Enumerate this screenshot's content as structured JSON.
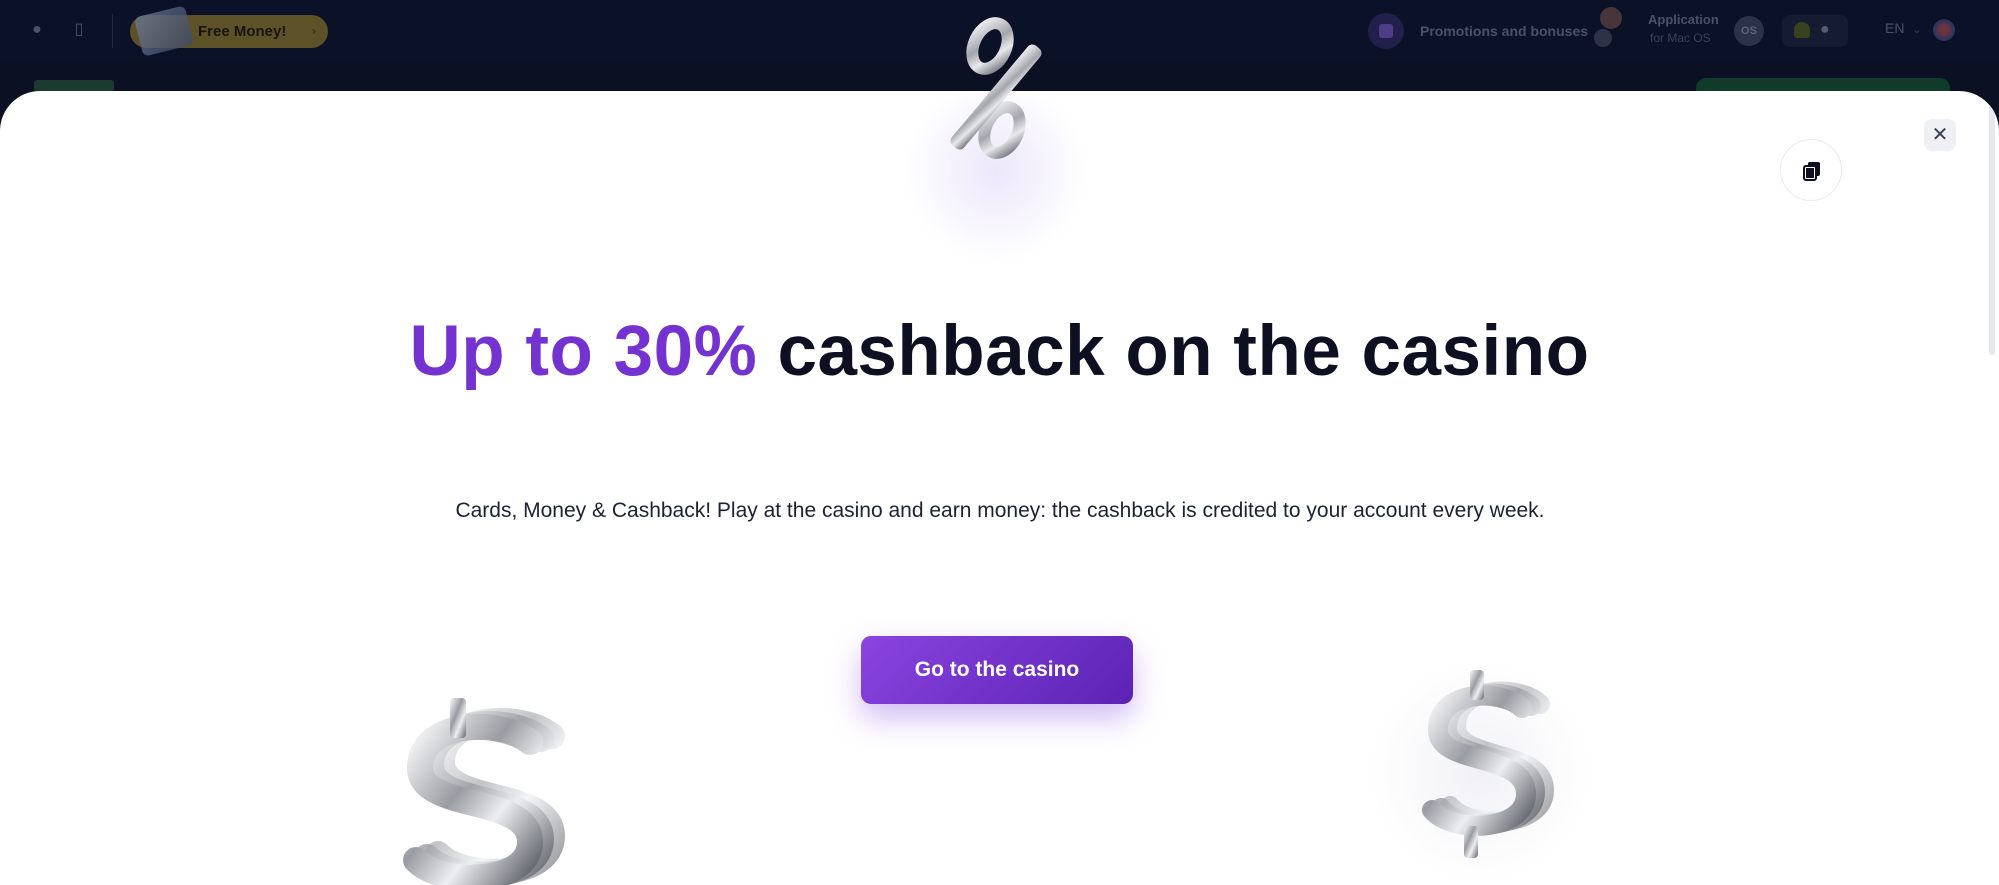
{
  "header": {
    "free_money_label": "Free Money!",
    "free_money_arrow": "›",
    "promotions_label": "Promotions and bonuses",
    "app_title": "Application",
    "app_subtitle": "for Mac OS",
    "app_badge": "OS",
    "language": "EN",
    "lang_chevron": "⌄"
  },
  "modal": {
    "close_symbol": "✕",
    "headline_accent": "Up to 30%",
    "headline_rest": " cashback on the casino",
    "subtitle": "Cards, Money & Cashback! Play at the casino and earn money: the cashback is credited to your account every week.",
    "cta_label": "Go to the casino"
  },
  "icons": {
    "top_left_1": "lock-icon",
    "top_left_2": "mobile-icon",
    "copy": "copy-icon",
    "close": "close-icon",
    "percent_decor": "percent-3d-icon",
    "dollar_left": "dollar-3d-icon",
    "dollar_right": "dollar-3d-icon"
  },
  "colors": {
    "accent_purple": "#7432d1",
    "button_start": "#8a44e0",
    "button_end": "#5b22b4",
    "header_bg": "#0b1126",
    "modal_bg": "#ffffff"
  }
}
